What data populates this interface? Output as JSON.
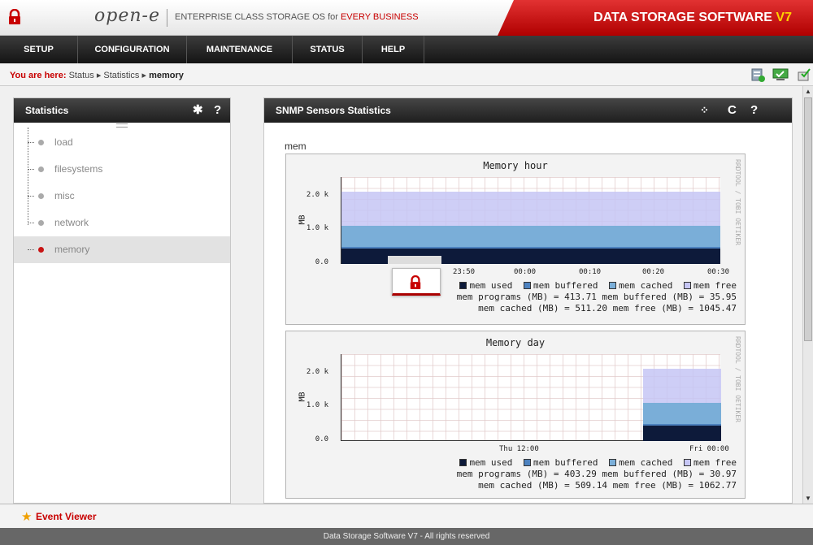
{
  "header": {
    "logo": "open-e",
    "tagline_pre": "ENTERPRISE CLASS STORAGE OS for ",
    "tagline_hl": "EVERY BUSINESS",
    "product": "DATA STORAGE SOFTWARE ",
    "version": "V7",
    "brand_color": "#c80000"
  },
  "menu": {
    "items": [
      "SETUP",
      "CONFIGURATION",
      "MAINTENANCE",
      "STATUS",
      "HELP"
    ]
  },
  "breadcrumb": {
    "label": "You are here:",
    "items": [
      "Status",
      "Statistics",
      "memory"
    ]
  },
  "left_panel": {
    "title": "Statistics",
    "tree": [
      "load",
      "filesystems",
      "misc",
      "network",
      "memory"
    ],
    "selected": "memory"
  },
  "right_panel": {
    "title": "SNMP Sensors Statistics",
    "section": "mem"
  },
  "graph_hour": {
    "title": "Memory hour",
    "ylabel": "MB",
    "yticks": [
      "2.0 k",
      "1.0 k",
      "0.0"
    ],
    "xticks": [
      "23:50",
      "00:00",
      "00:10",
      "00:20",
      "00:30"
    ],
    "legend": [
      "mem used",
      "mem buffered",
      "mem cached",
      "mem free"
    ],
    "line2": "mem programs (MB) = 413.71  mem buffered (MB) = 35.95",
    "line3": "mem cached (MB) = 511.20  mem free (MB) = 1045.47",
    "side": "RRDTOOL / TOBI OETIKER",
    "values": {
      "mem programs": 413.71,
      "mem buffered": 35.95,
      "mem cached": 511.2,
      "mem free": 1045.47
    }
  },
  "graph_day": {
    "title": "Memory day",
    "ylabel": "MB",
    "yticks": [
      "2.0 k",
      "1.0 k",
      "0.0"
    ],
    "xticks": [
      "Thu 12:00",
      "Fri 00:00"
    ],
    "legend": [
      "mem used",
      "mem buffered",
      "mem cached",
      "mem free"
    ],
    "line2": "mem programs (MB) = 403.29  mem buffered (MB) = 30.97",
    "line3": "mem cached (MB) = 509.14  mem free (MB) = 1062.77",
    "side": "RRDTOOL / TOBI OETIKER",
    "values": {
      "mem programs": 403.29,
      "mem buffered": 30.97,
      "mem cached": 509.14,
      "mem free": 1062.77
    }
  },
  "colors": {
    "used": "#0d1a3a",
    "buffered": "#4d82bf",
    "cached": "#7aaed8",
    "free": "#c6c6f5"
  },
  "footer": {
    "event_viewer": "Event Viewer",
    "copyright": "Data Storage Software V7 - All rights reserved"
  }
}
